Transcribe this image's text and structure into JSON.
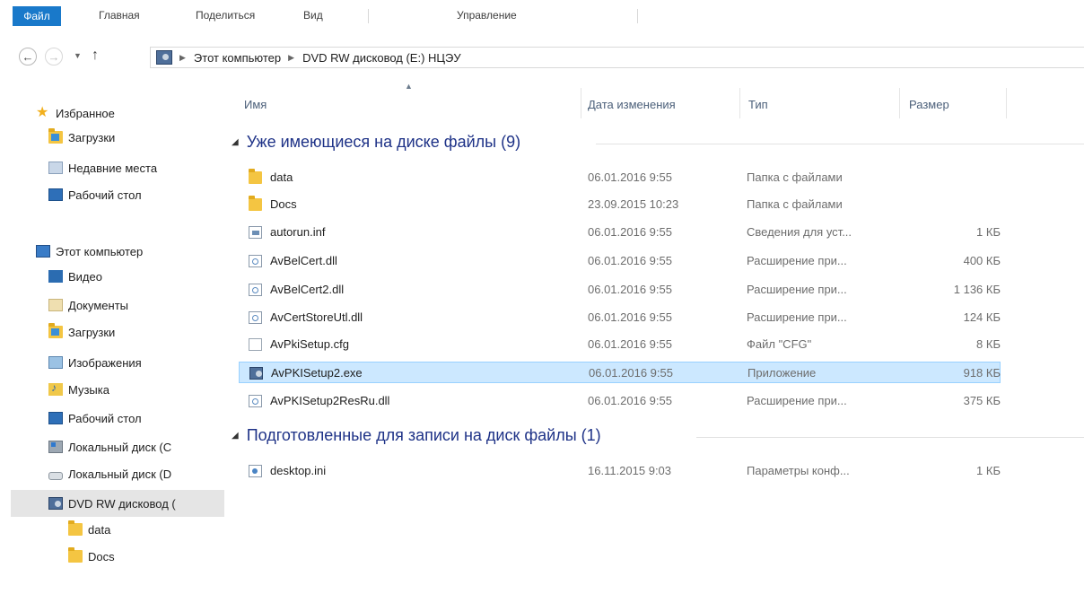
{
  "ribbon": {
    "tabs": [
      "Файл",
      "Главная",
      "Поделиться",
      "Вид",
      "Управление"
    ]
  },
  "address": {
    "segments": [
      "Этот компьютер",
      "DVD RW дисковод (E:) НЦЭУ"
    ]
  },
  "nav_pane": {
    "favorites_label": "Избранное",
    "favorites": [
      "Загрузки",
      "Недавние места",
      "Рабочий стол"
    ],
    "computer_label": "Этот компьютер",
    "computer_items": [
      "Видео",
      "Документы",
      "Загрузки",
      "Изображения",
      "Музыка",
      "Рабочий стол",
      "Локальный диск (C",
      "Локальный диск (D",
      "DVD RW дисковод ("
    ],
    "dvd_children": [
      "data",
      "Docs"
    ]
  },
  "columns": {
    "name": "Имя",
    "date": "Дата изменения",
    "type": "Тип",
    "size": "Размер"
  },
  "groups": [
    {
      "title": "Уже имеющиеся на диске файлы (9)",
      "files": [
        {
          "name": "data",
          "date": "06.01.2016 9:55",
          "type": "Папка с файлами",
          "size": "",
          "icon": "folder-icon"
        },
        {
          "name": "Docs",
          "date": "23.09.2015 10:23",
          "type": "Папка с файлами",
          "size": "",
          "icon": "folder-icon"
        },
        {
          "name": "autorun.inf",
          "date": "06.01.2016 9:55",
          "type": "Сведения для уст...",
          "size": "1 КБ",
          "icon": "inf-file-icon"
        },
        {
          "name": "AvBelCert.dll",
          "date": "06.01.2016 9:55",
          "type": "Расширение при...",
          "size": "400 КБ",
          "icon": "dll-file-icon"
        },
        {
          "name": "AvBelCert2.dll",
          "date": "06.01.2016 9:55",
          "type": "Расширение при...",
          "size": "1 136 КБ",
          "icon": "dll-file-icon"
        },
        {
          "name": "AvCertStoreUtl.dll",
          "date": "06.01.2016 9:55",
          "type": "Расширение при...",
          "size": "124 КБ",
          "icon": "dll-file-icon"
        },
        {
          "name": "AvPkiSetup.cfg",
          "date": "06.01.2016 9:55",
          "type": "Файл \"CFG\"",
          "size": "8 КБ",
          "icon": "cfg-file-icon"
        },
        {
          "name": "AvPKISetup2.exe",
          "date": "06.01.2016 9:55",
          "type": "Приложение",
          "size": "918 КБ",
          "icon": "exe-file-icon",
          "selected": true
        },
        {
          "name": "AvPKISetup2ResRu.dll",
          "date": "06.01.2016 9:55",
          "type": "Расширение при...",
          "size": "375 КБ",
          "icon": "dll-file-icon"
        }
      ]
    },
    {
      "title": "Подготовленные для записи на диск файлы (1)",
      "files": [
        {
          "name": "desktop.ini",
          "date": "16.11.2015 9:03",
          "type": "Параметры конф...",
          "size": "1 КБ",
          "icon": "ini-file-icon"
        }
      ]
    }
  ],
  "colors": {
    "file_tab": "#1979ca",
    "selection_bg": "#cce8ff",
    "selection_border": "#99d1ff",
    "group_title": "#1e3287",
    "nav_selected": "#e5e5e5"
  }
}
